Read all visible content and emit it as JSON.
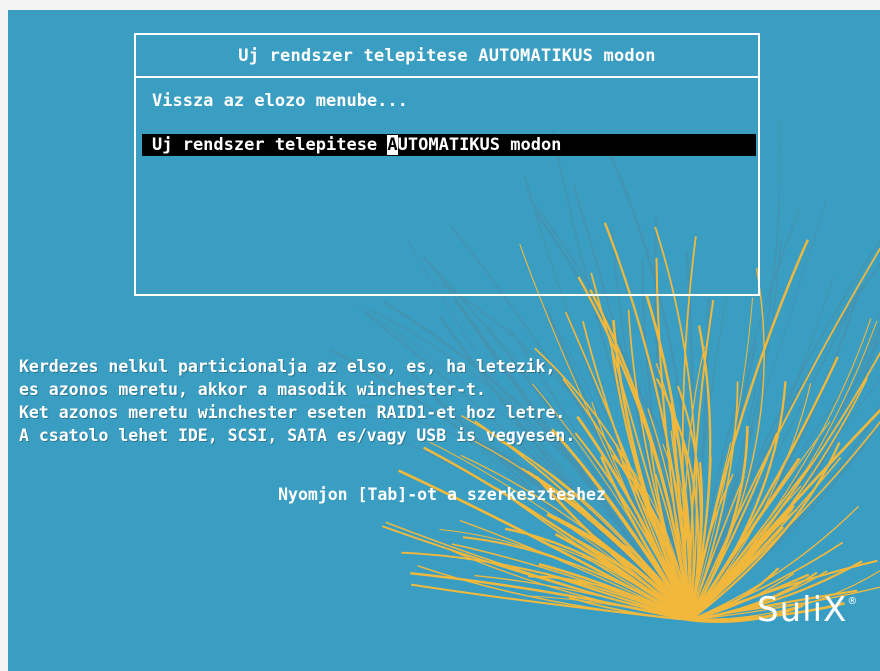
{
  "menu": {
    "title": "Uj rendszer telepitese AUTOMATIKUS modon",
    "items": [
      {
        "label": "Vissza az elozo menube..."
      },
      {
        "label_prefix": "Uj rendszer telepitese ",
        "cursor_char": "A",
        "label_suffix": "UTOMATIKUS modon"
      }
    ]
  },
  "help": {
    "lines": [
      "Kerdezes nelkul particionalja az elso, es, ha letezik,",
      "es azonos meretu, akkor a masodik winchester-t.",
      "Ket azonos meretu winchester eseten RAID1-et hoz letre.",
      "A csatolo lehet IDE, SCSI, SATA es/vagy USB is vegyesen."
    ]
  },
  "hint": "Nyomjon [Tab]-ot a szerkeszteshez",
  "logo": {
    "text": "SuliX",
    "mark": "®"
  },
  "colors": {
    "background": "#3a9ec2",
    "grass": "#f2b83c",
    "text": "#ffffff",
    "selection": "#000000"
  }
}
